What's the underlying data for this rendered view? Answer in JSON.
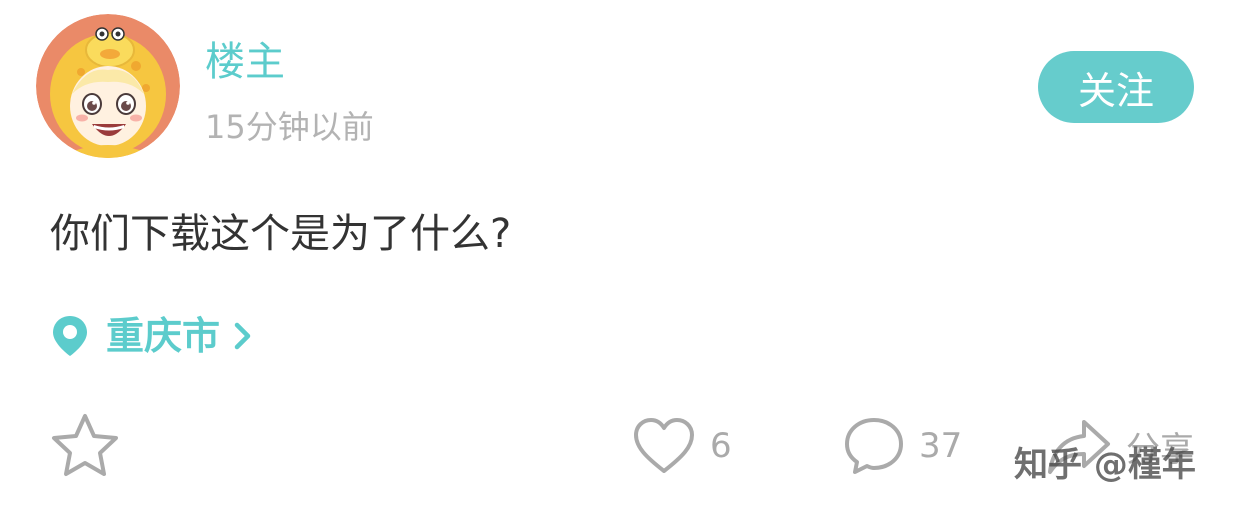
{
  "post": {
    "author": "楼主",
    "time": "15分钟以前",
    "follow_label": "关注",
    "text": "你们下载这个是为了什么?",
    "location": "重庆市"
  },
  "actions": {
    "likes": "6",
    "comments": "37",
    "share_label": "分享"
  },
  "watermark": "知乎 @槿年",
  "colors": {
    "accent": "#5ccccc",
    "follow_button": "#66cccc",
    "muted_text": "#b3b3b3",
    "body_text": "#333333",
    "icon_gray": "#aaaaaa"
  },
  "icons": {
    "location": "location-pin-icon",
    "chevron": "chevron-right-icon",
    "favorite": "star-icon",
    "like": "heart-icon",
    "comment": "comment-bubble-icon",
    "share": "share-arrow-icon"
  }
}
